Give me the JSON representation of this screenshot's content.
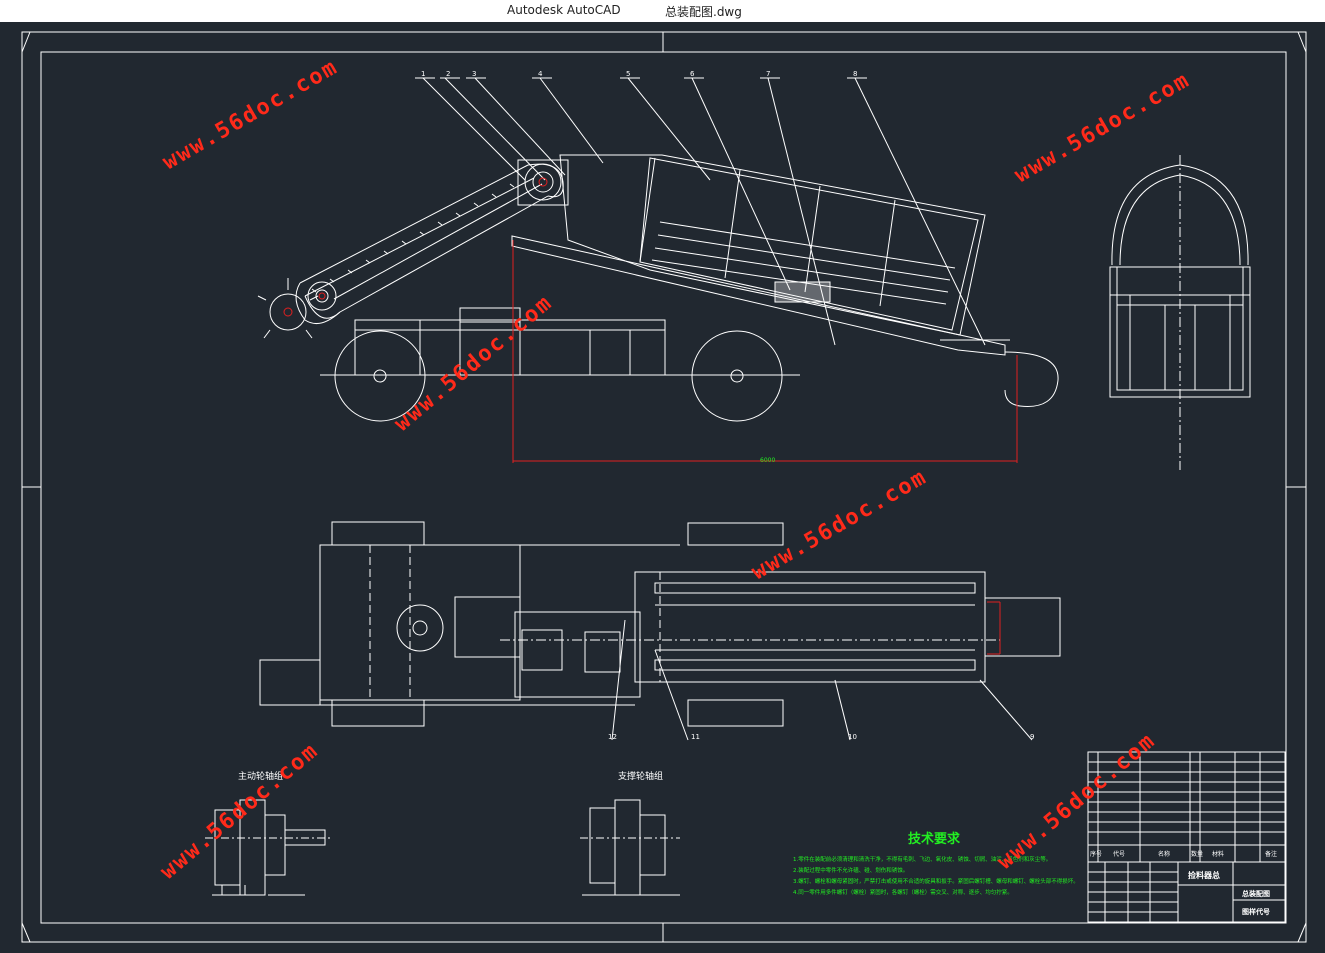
{
  "window": {
    "app_name": "Autodesk AutoCAD",
    "document_name": "总装配图.dwg"
  },
  "drawing": {
    "balloons_top": [
      "1",
      "2",
      "3",
      "4",
      "5",
      "6",
      "7",
      "8"
    ],
    "balloons_bottom": [
      "9",
      "10",
      "11",
      "12"
    ],
    "dimension_text": "6000",
    "detail_left_title": "主动轮轴组",
    "detail_right_title": "支撑轮轴组",
    "tech_title": "技术要求",
    "tech_lines": [
      "1.零件在装配前必须清理和清洗干净，不得有毛刺、飞边、氧化皮、锈蚀、切屑、油污、着色剂和灰尘等。",
      "2.装配过程中零件不允许磕、碰、划伤和锈蚀。",
      "3.螺钉、螺栓和螺母紧固时，严禁打击或使用不合适的旋具和扳手。紧固后螺钉槽、螺母和螺钉、螺栓头部不得损坏。",
      "4.同一零件用多件螺钉（螺栓）紧固时，各螺钉（螺栓）需交叉、对称、逐步、均匀拧紧。"
    ],
    "title_block": {
      "part_name": "捡料器总",
      "drawing_name": "总装配图",
      "drawing_code": "图样代号",
      "col_labels": [
        "序号",
        "代号",
        "名称",
        "数量",
        "材料",
        "备注"
      ]
    },
    "watermark": "www.56doc.com"
  },
  "colors": {
    "background": "#212830",
    "line": "#ffffff",
    "dimension": "#e02020",
    "text_green": "#22ee22",
    "watermark": "#ff2a1a"
  }
}
